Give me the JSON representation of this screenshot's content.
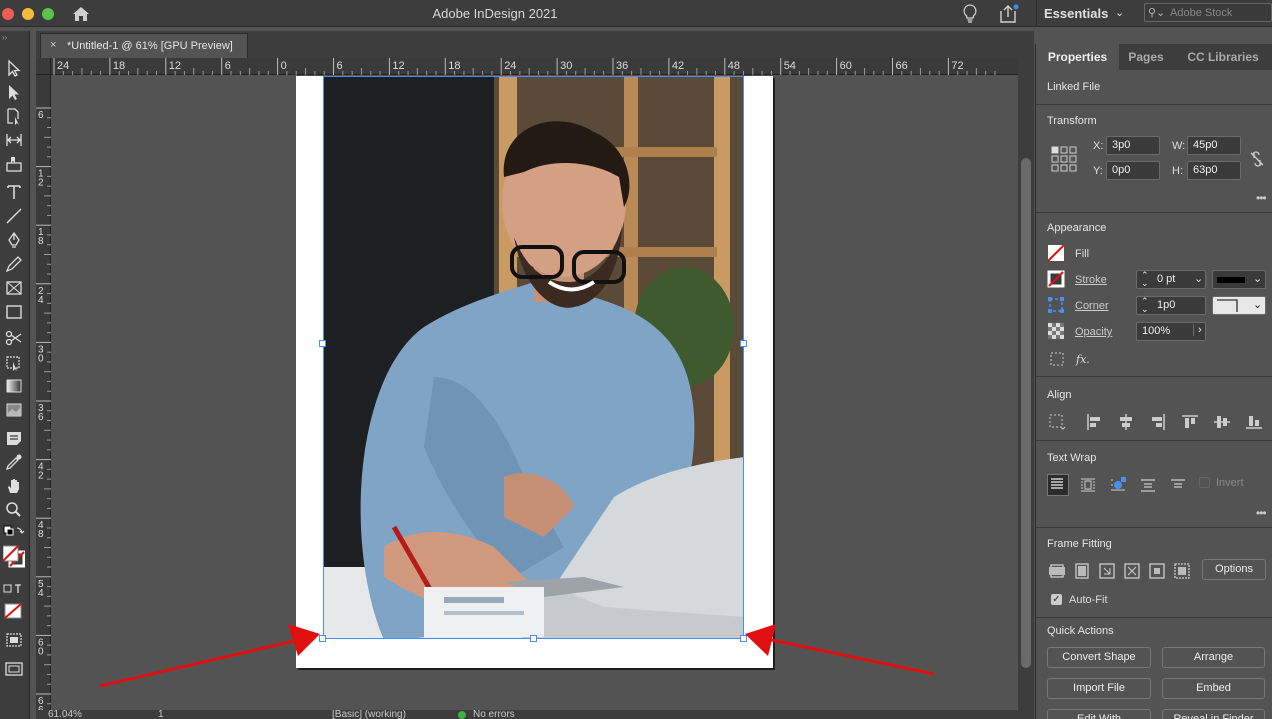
{
  "window": {
    "title": "Adobe InDesign 2021",
    "workspace": "Essentials",
    "stock_search_placeholder": "Adobe Stock"
  },
  "document_tab": {
    "close_glyph": "×",
    "label": "*Untitled-1 @ 61% [GPU Preview]"
  },
  "ruler": {
    "horizontal": [
      "24",
      "18",
      "12",
      "6",
      "0",
      "6",
      "12",
      "18",
      "24",
      "30",
      "36",
      "42",
      "48",
      "54",
      "60",
      "66",
      "72"
    ],
    "vertical": [
      [
        "6"
      ],
      [
        "1",
        "2"
      ],
      [
        "1",
        "8"
      ],
      [
        "2",
        "4"
      ],
      [
        "3",
        "0"
      ],
      [
        "3",
        "6"
      ],
      [
        "4",
        "2"
      ],
      [
        "4",
        "8"
      ],
      [
        "5",
        "4"
      ],
      [
        "6",
        "0"
      ],
      [
        "6",
        "6"
      ]
    ]
  },
  "panel": {
    "tabs": [
      "Properties",
      "Pages",
      "CC Libraries"
    ],
    "linked_file": "Linked File",
    "transform": {
      "title": "Transform",
      "x_label": "X:",
      "x_value": "3p0",
      "y_label": "Y:",
      "y_value": "0p0",
      "w_label": "W:",
      "w_value": "45p0",
      "h_label": "H:",
      "h_value": "63p0"
    },
    "appearance": {
      "title": "Appearance",
      "fill_label": "Fill",
      "stroke_label": "Stroke",
      "stroke_value": "0 pt",
      "corner_label": "Corner",
      "corner_value": "1p0",
      "opacity_label": "Opacity",
      "opacity_value": "100%",
      "fx_label": "fx."
    },
    "align": {
      "title": "Align"
    },
    "text_wrap": {
      "title": "Text Wrap",
      "invert_label": "Invert"
    },
    "frame_fitting": {
      "title": "Frame Fitting",
      "options_label": "Options",
      "autofit_label": "Auto-Fit"
    },
    "quick_actions": {
      "title": "Quick Actions",
      "convert_shape": "Convert Shape",
      "arrange": "Arrange",
      "import_file": "Import File",
      "embed": "Embed",
      "edit_with": "Edit With",
      "reveal_in_finder": "Reveal in Finder"
    }
  },
  "status": {
    "zoom": "61.04%",
    "page": "1",
    "preflight_profile": "[Basic] (working)",
    "errors": "No errors"
  },
  "colors": {
    "selection": "#4a8ef0",
    "annotation_arrow": "#e01010",
    "no_errors_dot": "#3fae3f"
  }
}
